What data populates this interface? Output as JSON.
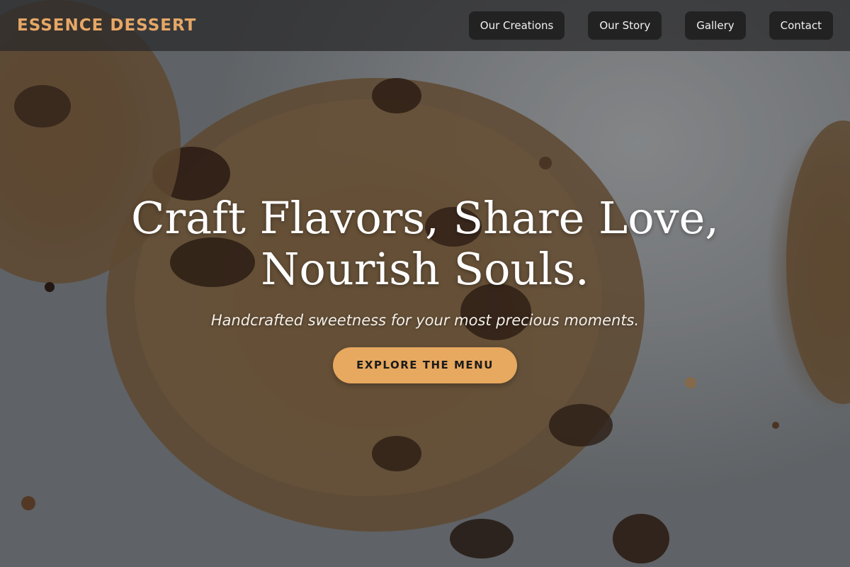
{
  "brand": {
    "name": "ESSENCE DESSERT",
    "color": "#e6a766"
  },
  "nav": {
    "items": [
      {
        "label": "Our Creations"
      },
      {
        "label": "Our Story"
      },
      {
        "label": "Gallery"
      },
      {
        "label": "Contact"
      }
    ]
  },
  "hero": {
    "title_line1": "Craft Flavors, Share Love,",
    "title_line2": "Nourish Souls.",
    "subtitle": "Handcrafted sweetness for your most precious moments.",
    "cta_label": "EXPLORE THE MENU",
    "cta_color": "#e7a85f",
    "background_image": "chocolate chip cookies on parchment"
  }
}
